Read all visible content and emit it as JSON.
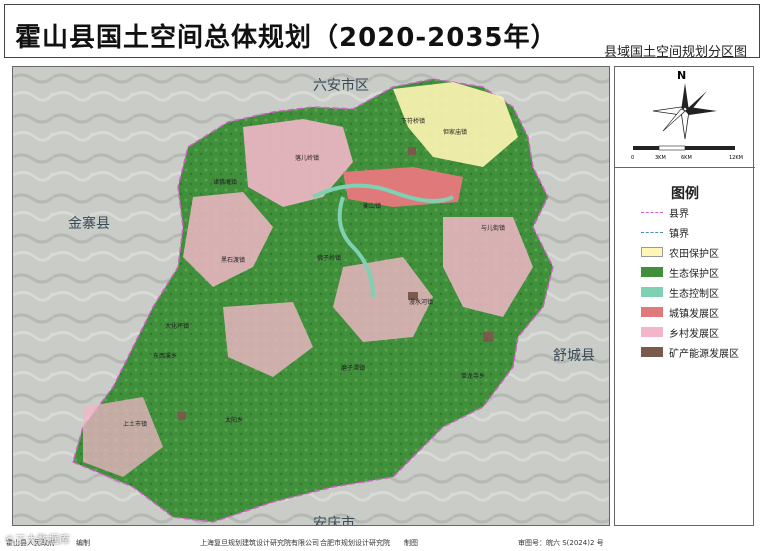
{
  "title": "霍山县国土空间总体规划（2020-2035年）",
  "subtitle": "县域国土空间规划分区图",
  "scale": {
    "north": "N",
    "ticks": [
      "0",
      "3KM",
      "6KM",
      "12KM"
    ]
  },
  "legend": {
    "title": "图例",
    "items": [
      {
        "label": "县界",
        "color": "#d55fc9",
        "type": "line"
      },
      {
        "label": "镇界",
        "color": "#4a8fb0",
        "type": "line"
      },
      {
        "label": "农田保护区",
        "color": "#fff6b5",
        "type": "fill"
      },
      {
        "label": "生态保护区",
        "color": "#3f8f3b",
        "type": "fill"
      },
      {
        "label": "生态控制区",
        "color": "#7fd1b3",
        "type": "fill"
      },
      {
        "label": "城镇发展区",
        "color": "#e07a7a",
        "type": "fill"
      },
      {
        "label": "乡村发展区",
        "color": "#f2b6c8",
        "type": "fill"
      },
      {
        "label": "矿产能源发展区",
        "color": "#7a5a4a",
        "type": "fill"
      }
    ]
  },
  "neighbors": {
    "north": "六安市区",
    "west": "金寨县",
    "east": "舒城县",
    "south": "安庆市"
  },
  "towns": [
    "下符桥镇",
    "但家庙镇",
    "落儿岭镇",
    "诸佛庵镇",
    "衡山镇",
    "与儿街镇",
    "佛子岭镇",
    "黑石渡镇",
    "东西溪乡",
    "漫水河镇",
    "大化坪镇",
    "单龙寺乡",
    "磨子潭镇",
    "太阳乡",
    "上土市镇"
  ],
  "footer": {
    "left": "霍山县人民政府",
    "compile": "编制",
    "org1": "上海复旦规划建筑设计研究院有限公司",
    "org2": "合肥市规划设计研究院",
    "draw": "制图",
    "approval": "审图号：皖六 S(2024)2 号",
    "watermark": "©三大数据库"
  }
}
